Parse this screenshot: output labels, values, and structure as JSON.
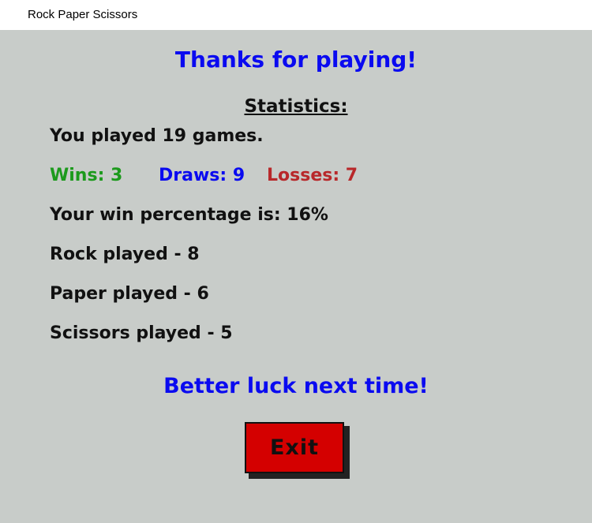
{
  "window": {
    "title": "Rock Paper Scissors"
  },
  "screen": {
    "heading": "Thanks for playing!",
    "statistics_title": "Statistics:",
    "games_played": "You played 19 games.",
    "wins": "Wins: 3",
    "draws": "Draws: 9",
    "losses": "Losses: 7",
    "win_percentage": "Your win percentage is: 16%",
    "rock_played": "Rock played - 8",
    "paper_played": "Paper played - 6",
    "scissors_played": "Scissors played - 5",
    "message": "Better luck next time!",
    "exit_label": "Exit"
  },
  "colors": {
    "background": "#c8ccc9",
    "heading_blue": "#0a0af0",
    "wins_green": "#1c9a1c",
    "losses_red": "#b8282a",
    "exit_button_red": "#d40000"
  }
}
